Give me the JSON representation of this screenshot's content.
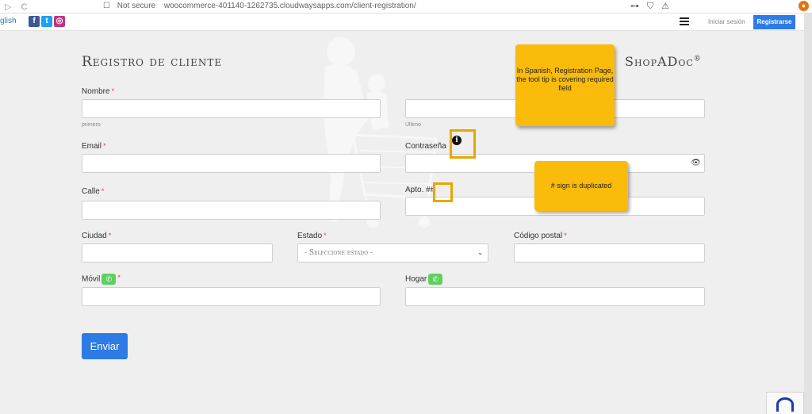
{
  "browser": {
    "security_label": "Not secure",
    "url": "woocommerce-401140-1262735.cloudwaysapps.com/client-registration/"
  },
  "topbar": {
    "language": "glish",
    "login_label": "Iniciar sesión",
    "register_label": "Registrarse"
  },
  "page": {
    "title": "Registro de cliente",
    "brand": "ShopADoc",
    "brand_mark": "®"
  },
  "form": {
    "first_name": {
      "label": "Nombre",
      "hint": "primero",
      "value": ""
    },
    "last_name": {
      "hint": "Último",
      "value": ""
    },
    "email": {
      "label": "Email",
      "value": ""
    },
    "password": {
      "label": "Contraseña",
      "value": ""
    },
    "street": {
      "label": "Calle",
      "value": ""
    },
    "apt": {
      "label": "Apto. #",
      "extra": "#",
      "value": ""
    },
    "city": {
      "label": "Ciudad",
      "value": ""
    },
    "state": {
      "label": "Estado",
      "selected": "- Seleccione estado -"
    },
    "zip": {
      "label": "Código postal",
      "value": ""
    },
    "mobile": {
      "label": "Móvil",
      "value": ""
    },
    "home": {
      "label": "Hogar",
      "value": ""
    },
    "required_mark": "*",
    "submit_label": "Enviar"
  },
  "annotations": {
    "note_tooltip": "In Spanish, Registration Page, the tool tip is covering required field",
    "note_hash": "# sign is duplicated"
  },
  "colors": {
    "accent": "#2d7be5",
    "required": "#e53935",
    "note": "#fbbb0a",
    "phone": "#5ed05e"
  }
}
